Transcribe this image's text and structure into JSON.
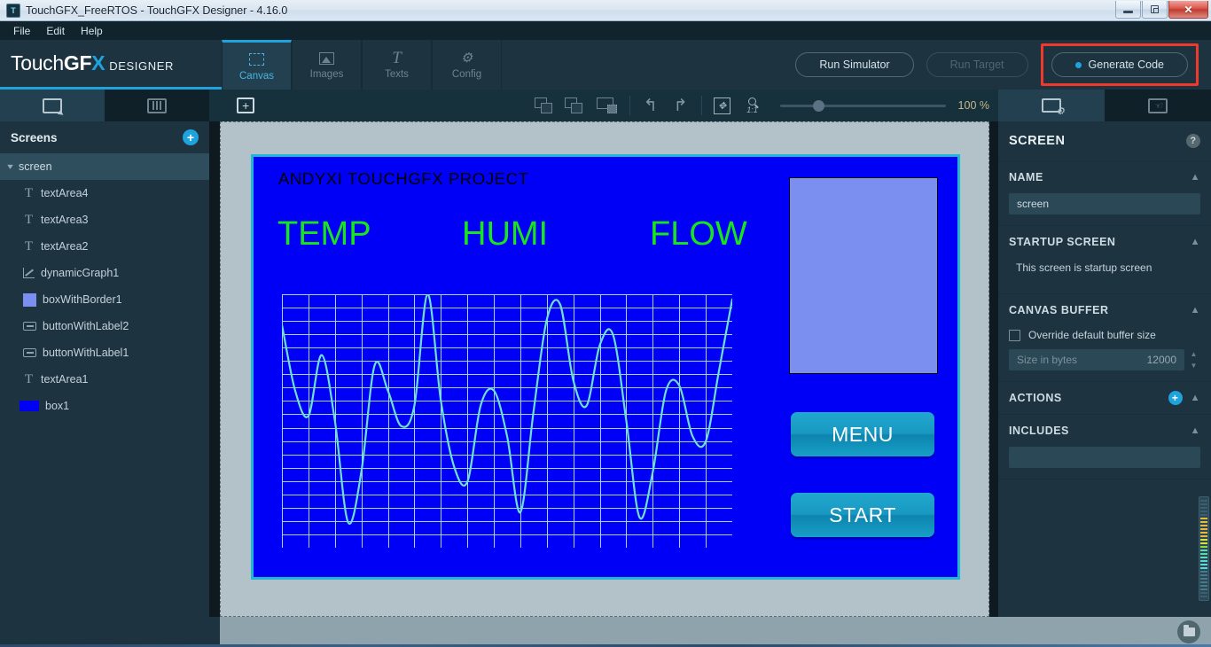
{
  "window": {
    "title": "TouchGFX_FreeRTOS - TouchGFX Designer - 4.16.0",
    "app_icon": "touchgfx-icon",
    "controls": {
      "minimize": "minimize-icon",
      "restore": "restore-icon",
      "close": "✕"
    }
  },
  "menubar": {
    "items": [
      "File",
      "Edit",
      "Help"
    ]
  },
  "logo": {
    "part1": "Touch",
    "part2": "GF",
    "part3": "X",
    "suffix": "DESIGNER"
  },
  "main_tabs": [
    {
      "label": "Canvas",
      "icon": "canvas-icon",
      "active": true
    },
    {
      "label": "Images",
      "icon": "images-icon",
      "active": false
    },
    {
      "label": "Texts",
      "icon": "texts-icon",
      "active": false
    },
    {
      "label": "Config",
      "icon": "config-icon",
      "active": false
    }
  ],
  "header_buttons": [
    {
      "label": "Run Simulator",
      "enabled": true,
      "highlighted": false
    },
    {
      "label": "Run Target",
      "enabled": false,
      "highlighted": false
    },
    {
      "label": "Generate Code",
      "enabled": true,
      "highlighted": true
    }
  ],
  "highlight_color": "#f0392b",
  "accent_color": "#1fa3dd",
  "left_panel": {
    "tabs": [
      {
        "icon": "screens-tab-icon",
        "active": true
      },
      {
        "icon": "sliders-tab-icon",
        "active": false
      }
    ],
    "header": {
      "title": "Screens",
      "add_label": "+"
    },
    "tree": {
      "root": {
        "label": "screen",
        "expanded": true
      },
      "items": [
        {
          "label": "textArea4",
          "icon": "text-icon"
        },
        {
          "label": "textArea3",
          "icon": "text-icon"
        },
        {
          "label": "textArea2",
          "icon": "text-icon"
        },
        {
          "label": "dynamicGraph1",
          "icon": "graph-icon"
        },
        {
          "label": "boxWithBorder1",
          "icon": "box-with-border-icon"
        },
        {
          "label": "buttonWithLabel2",
          "icon": "button-icon"
        },
        {
          "label": "buttonWithLabel1",
          "icon": "button-icon"
        },
        {
          "label": "textArea1",
          "icon": "text-icon"
        },
        {
          "label": "box1",
          "icon": "box-icon"
        }
      ]
    }
  },
  "canvas_toolbar": {
    "add_label": "+",
    "layer_buttons": [
      "bring-to-front-icon",
      "send-to-back-icon",
      "snap-icon"
    ],
    "undo": "↰",
    "redo": "↱",
    "fit_icon": "fit-to-screen-icon",
    "zoom_one_to_one": "1:1",
    "zoom_value": "100 %",
    "zoom_percent": 100
  },
  "canvas": {
    "screen_title": "ANDYXI TOUCHGFX PROJECT",
    "metrics": [
      "TEMP",
      "HUMI",
      "FLOW"
    ],
    "metric_color": "#19e619",
    "background_color": "#0000f6",
    "selection_color": "#1fb6d8",
    "side_box_color": "#7b8ff0",
    "buttons": [
      {
        "label": "MENU"
      },
      {
        "label": "START"
      }
    ]
  },
  "chart_data": {
    "type": "line",
    "title": "dynamicGraph1",
    "series": [
      {
        "name": "flow",
        "color": "#6fe0cf",
        "values": [
          88,
          62,
          52,
          76,
          50,
          10,
          30,
          72,
          62,
          48,
          56,
          100,
          58,
          32,
          26,
          56,
          62,
          44,
          14,
          54,
          90,
          96,
          66,
          56,
          80,
          84,
          50,
          12,
          30,
          62,
          64,
          44,
          42,
          70,
          98
        ]
      }
    ],
    "ylim": [
      0,
      100
    ],
    "xlim": [
      0,
      34
    ],
    "grid": true,
    "grid_color": "#9fd8e8",
    "legend": "none",
    "xlabel": "",
    "ylabel": "",
    "grid_cols": 17,
    "grid_rows": 19
  },
  "right_panel": {
    "tabs": [
      {
        "icon": "screen-properties-icon",
        "active": true
      },
      {
        "icon": "interactions-icon",
        "active": false
      }
    ],
    "title": "SCREEN",
    "help_label": "?",
    "sections": [
      {
        "key": "name",
        "title": "NAME",
        "value": "screen"
      },
      {
        "key": "startup",
        "title": "STARTUP SCREEN",
        "text": "This screen is startup screen"
      },
      {
        "key": "canvas_buffer",
        "title": "CANVAS BUFFER",
        "checkbox_label": "Override default buffer size",
        "checked": false,
        "size_placeholder": "Size in bytes",
        "size_value": "12000"
      },
      {
        "key": "actions",
        "title": "ACTIONS",
        "add_label": "+"
      },
      {
        "key": "includes",
        "title": "INCLUDES",
        "value": ""
      }
    ]
  },
  "status_bar": {
    "archive_icon": "archive-folder-icon"
  }
}
